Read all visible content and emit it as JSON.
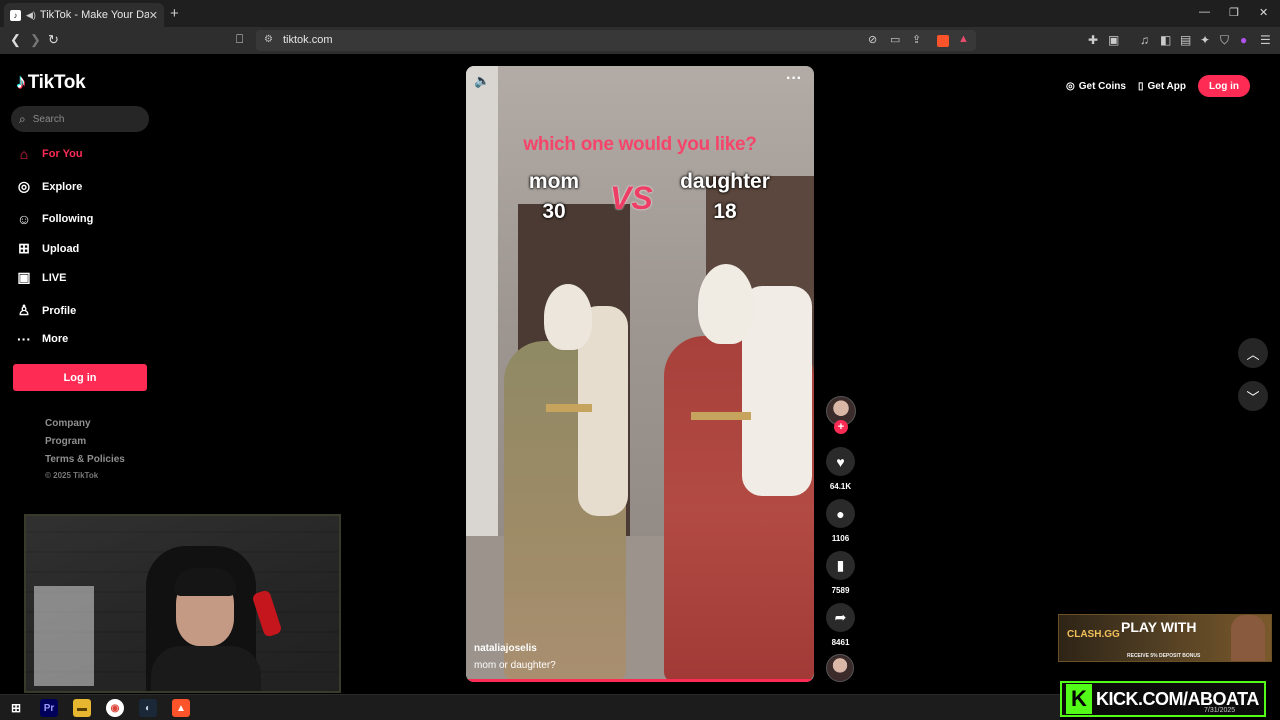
{
  "browser": {
    "tab_title": "TikTok - Make Your Day",
    "url": "tiktok.com"
  },
  "sidebar": {
    "logo": "TikTok",
    "search_placeholder": "Search",
    "items": [
      {
        "label": "For You",
        "icon": "home-icon"
      },
      {
        "label": "Explore",
        "icon": "compass-icon"
      },
      {
        "label": "Following",
        "icon": "following-icon"
      },
      {
        "label": "Upload",
        "icon": "upload-icon"
      },
      {
        "label": "LIVE",
        "icon": "live-icon"
      },
      {
        "label": "Profile",
        "icon": "profile-icon"
      },
      {
        "label": "More",
        "icon": "more-icon"
      }
    ],
    "login_label": "Log in",
    "footer_links": [
      "Company",
      "Program",
      "Terms & Policies"
    ],
    "copyright": "© 2025 TikTok"
  },
  "header": {
    "get_coins": "Get Coins",
    "get_app": "Get App",
    "login": "Log in"
  },
  "video": {
    "overlay_title": "which one would you like?",
    "left_label": "mom",
    "left_age": "30",
    "vs": "VS",
    "right_label": "daughter",
    "right_age": "18",
    "author": "nataliajoselis",
    "description": "mom or daughter?",
    "progress": 1.0
  },
  "actions": {
    "likes": "64.1K",
    "comments": "1106",
    "saves": "7589",
    "shares": "8461"
  },
  "ads": {
    "clash_brand": "CLASH.GG",
    "clash_headline": "PLAY WITH",
    "clash_sub": "RECEIVE 5% DEPOSIT BONUS",
    "kick": "KICK.COM/ABOATA"
  },
  "taskbar": {
    "date": "7/31/2025"
  },
  "colors": {
    "accent": "#fe2c55",
    "background": "#000000",
    "kick_green": "#53fc18"
  }
}
